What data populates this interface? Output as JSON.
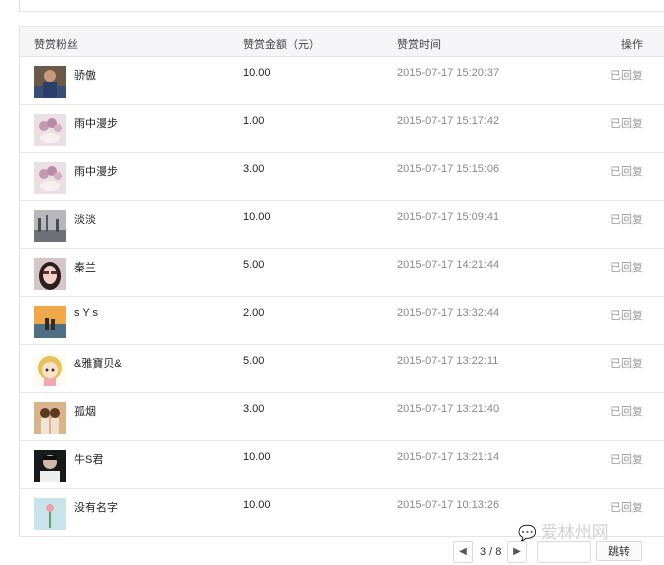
{
  "table": {
    "headers": {
      "fan": "赞赏粉丝",
      "amount": "赞赏金额（元）",
      "time": "赞赏时间",
      "action": "操作"
    },
    "rows": [
      {
        "name": "骄傲",
        "amount": "10.00",
        "time": "2015-07-17 15:20:37",
        "status": "已回复",
        "avatar": "man-photo-avatar"
      },
      {
        "name": "雨中漫步",
        "amount": "1.00",
        "time": "2015-07-17 15:17:42",
        "status": "已回复",
        "avatar": "flowers-cup-avatar"
      },
      {
        "name": "雨中漫步",
        "amount": "3.00",
        "time": "2015-07-17 15:15:06",
        "status": "已回复",
        "avatar": "flowers-cup-avatar"
      },
      {
        "name": "淡淡",
        "amount": "10.00",
        "time": "2015-07-17 15:09:41",
        "status": "已回复",
        "avatar": "gray-scene-avatar"
      },
      {
        "name": "秦兰",
        "amount": "5.00",
        "time": "2015-07-17 14:21:44",
        "status": "已回复",
        "avatar": "woman-sunglasses-avatar"
      },
      {
        "name": "s Y s",
        "amount": "2.00",
        "time": "2015-07-17 13:32:44",
        "status": "已回复",
        "avatar": "couple-scene-avatar"
      },
      {
        "name": "&雅寶贝&",
        "amount": "5.00",
        "time": "2015-07-17 13:22:11",
        "status": "已回复",
        "avatar": "cartoon-girl-avatar"
      },
      {
        "name": "孤烟",
        "amount": "3.00",
        "time": "2015-07-17 13:21:40",
        "status": "已回复",
        "avatar": "girls-photo-avatar"
      },
      {
        "name": "牛S君",
        "amount": "10.00",
        "time": "2015-07-17 13:21:14",
        "status": "已回复",
        "avatar": "man-dark-avatar"
      },
      {
        "name": "没有名字",
        "amount": "10.00",
        "time": "2015-07-17 10:13:26",
        "status": "已回复",
        "avatar": "pink-flower-avatar"
      }
    ]
  },
  "pagination": {
    "page_label": "3 / 8",
    "prev_icon": "chevron-left-icon",
    "next_icon": "chevron-right-icon",
    "jump_label": "跳转",
    "input_value": ""
  },
  "watermark": {
    "text": "爱林州网",
    "icon": "wechat-icon"
  },
  "colors": {
    "header_bg": "#f5f5f7",
    "border": "#e4e4e4",
    "time_text": "#888888",
    "status_text": "#999999"
  }
}
